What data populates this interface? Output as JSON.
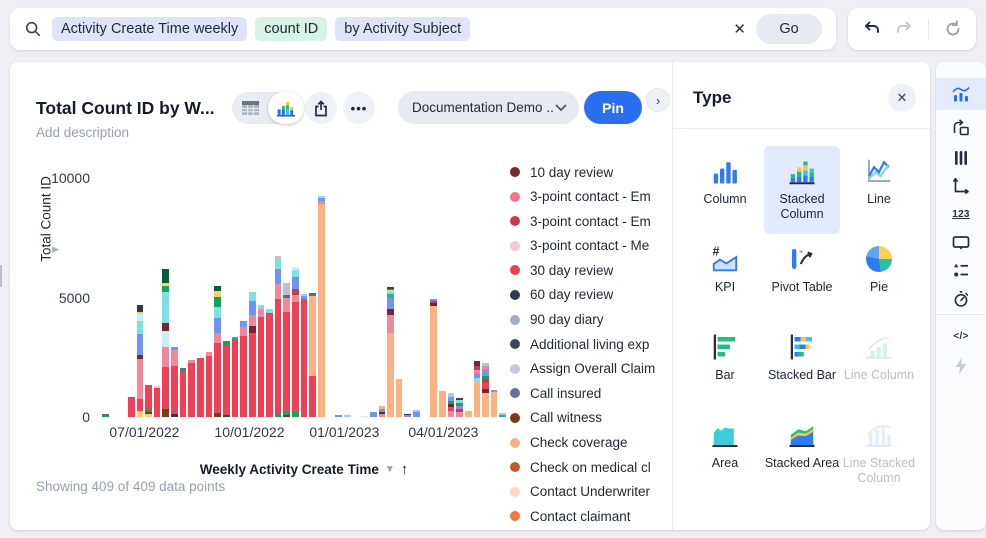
{
  "topbar": {
    "tokens": [
      {
        "text": "Activity Create Time weekly",
        "kind": "time"
      },
      {
        "text": "count ID",
        "kind": "measure"
      },
      {
        "text": "by Activity Subject",
        "kind": "attribute"
      }
    ],
    "clear_label": "✕",
    "go_label": "Go"
  },
  "chart_panel": {
    "title": "Total Count ID by W...",
    "description_placeholder": "Add description",
    "dataset_label": "Documentation Demo ...",
    "pin_label": "Pin",
    "footer": "Showing 409 of 409 data points",
    "x_axis_label": "Weekly Activity Create Time",
    "y_axis_label": "Total Count ID"
  },
  "legend": {
    "items": [
      {
        "label": "10 day review",
        "color": "#7c2333"
      },
      {
        "label": "3-point contact - Em",
        "color": "#ef7585"
      },
      {
        "label": "3-point contact - Em",
        "color": "#c13e52"
      },
      {
        "label": "3-point contact - Me",
        "color": "#f8c8d0"
      },
      {
        "label": "30 day review",
        "color": "#ee4156"
      },
      {
        "label": "60 day review",
        "color": "#2e3a50"
      },
      {
        "label": "90 day diary",
        "color": "#a3aec2"
      },
      {
        "label": "Additional living exp",
        "color": "#3c485c"
      },
      {
        "label": "Assign Overall Claim",
        "color": "#c3cbd8"
      },
      {
        "label": "Call insured",
        "color": "#67748c"
      },
      {
        "label": "Call witness",
        "color": "#7a3b16"
      },
      {
        "label": "Check coverage",
        "color": "#fcb183"
      },
      {
        "label": "Check on medical cl",
        "color": "#c45a24"
      },
      {
        "label": "Contact Underwriter",
        "color": "#fcd9c2"
      },
      {
        "label": "Contact claimant",
        "color": "#f4773c"
      }
    ]
  },
  "chart_data": {
    "type": "bar",
    "stacked": true,
    "title": "Total Count ID by Weekly Activity Create Time",
    "xlabel": "Weekly Activity Create Time",
    "ylabel": "Total Count ID",
    "ylim": [
      0,
      10000
    ],
    "y_ticks": [
      "10000",
      "5000",
      "0"
    ],
    "x_ticks": [
      {
        "label": "07/01/2022",
        "pos_pct": 10.5
      },
      {
        "label": "10/01/2022",
        "pos_pct": 36.5
      },
      {
        "label": "01/01/2023",
        "pos_pct": 60.0
      },
      {
        "label": "04/01/2023",
        "pos_pct": 84.5
      }
    ],
    "palette": {
      "red": "#ee4156",
      "pink": "#f2879a",
      "lightpink": "#f8c8d0",
      "maroon": "#7c2333",
      "darkred": "#c13e52",
      "navy": "#2e3a50",
      "slate": "#5d6b80",
      "lightslate": "#b9c2d0",
      "brown": "#7a3b16",
      "orange": "#fcb183",
      "burnt": "#c45a24",
      "peach": "#fcd9c2",
      "coral": "#f4773c",
      "blue": "#6d96f0",
      "lightblue": "#a9c7f7",
      "cyan": "#7ee0e3",
      "lightcyan": "#c9f0f2",
      "teal": "#2aaf9f",
      "green": "#18a15c",
      "darkgreen": "#0d5c38",
      "yellow": "#f6cf6e",
      "purple": "#9b86ef"
    },
    "bars": [
      [
        [
          "green",
          60
        ],
        [
          "slate",
          70
        ]
      ],
      [],
      [],
      [
        [
          "red",
          780
        ],
        [
          "green",
          60
        ]
      ],
      [
        [
          "yellow",
          260
        ],
        [
          "red",
          500
        ],
        [
          "pink",
          1650
        ],
        [
          "maroon",
          170
        ],
        [
          "blue",
          900
        ],
        [
          "cyan",
          550
        ],
        [
          "lightcyan",
          270
        ],
        [
          "yellow",
          100
        ],
        [
          "navy",
          300
        ]
      ],
      [
        [
          "yellow",
          120
        ],
        [
          "brown",
          110
        ],
        [
          "green",
          120
        ],
        [
          "red",
          1000
        ]
      ],
      [
        [
          "red",
          1230
        ],
        [
          "lightpink",
          70
        ]
      ],
      [
        [
          "brown",
          340
        ],
        [
          "red",
          1750
        ],
        [
          "pink",
          830
        ],
        [
          "lightcyan",
          680
        ],
        [
          "maroon",
          320
        ],
        [
          "cyan",
          1300
        ],
        [
          "green",
          280
        ],
        [
          "yellow",
          100
        ],
        [
          "darkgreen",
          600
        ]
      ],
      [
        [
          "navy",
          120
        ],
        [
          "red",
          2000
        ],
        [
          "pink",
          680
        ],
        [
          "blue",
          150
        ]
      ],
      [
        [
          "red",
          1900
        ],
        [
          "green",
          100
        ],
        [
          "slate",
          50
        ]
      ],
      [
        [
          "red",
          2280
        ],
        [
          "pink",
          120
        ]
      ],
      [
        [
          "red",
          2450
        ]
      ],
      [
        [
          "red",
          2550
        ],
        [
          "pink",
          150
        ]
      ],
      [
        [
          "brown",
          180
        ],
        [
          "red",
          2900
        ],
        [
          "pink",
          450
        ],
        [
          "blue",
          600
        ],
        [
          "cyan",
          480
        ],
        [
          "green",
          420
        ],
        [
          "yellow",
          250
        ],
        [
          "darkgreen",
          200
        ]
      ],
      [
        [
          "darkgreen",
          80
        ],
        [
          "red",
          2950
        ],
        [
          "green",
          170
        ]
      ],
      [
        [
          "red",
          3250
        ],
        [
          "teal",
          100
        ]
      ],
      [
        [
          "red",
          3400
        ],
        [
          "pink",
          350
        ],
        [
          "blue",
          250
        ]
      ],
      [
        [
          "red",
          3500
        ],
        [
          "maroon",
          300
        ],
        [
          "pink",
          450
        ],
        [
          "blue",
          600
        ],
        [
          "cyan",
          400
        ]
      ],
      [
        [
          "red",
          4200
        ],
        [
          "pink",
          300
        ],
        [
          "lightblue",
          200
        ]
      ],
      [
        [
          "red",
          4350
        ],
        [
          "cyan",
          150
        ]
      ],
      [
        [
          "green",
          150
        ],
        [
          "red",
          4800
        ],
        [
          "pink",
          600
        ],
        [
          "blue",
          650
        ],
        [
          "cyan",
          400
        ],
        [
          "lightslate",
          150
        ]
      ],
      [
        [
          "brown",
          100
        ],
        [
          "green",
          130
        ],
        [
          "red",
          4170
        ],
        [
          "pink",
          600
        ],
        [
          "slate",
          100
        ],
        [
          "lightslate",
          500
        ]
      ],
      [
        [
          "green",
          200
        ],
        [
          "red",
          4600
        ],
        [
          "pink",
          300
        ],
        [
          "darkred",
          250
        ],
        [
          "blue",
          500
        ],
        [
          "cyan",
          300
        ],
        [
          "lightcyan",
          150
        ]
      ],
      [
        [
          "red",
          4950
        ],
        [
          "blue",
          120
        ],
        [
          "lightblue",
          80
        ]
      ],
      [
        [
          "red",
          1700
        ],
        [
          "orange",
          3350
        ],
        [
          "slate",
          150
        ]
      ],
      [
        [
          "orange",
          8900
        ],
        [
          "pink",
          150
        ],
        [
          "blue",
          100
        ],
        [
          "yellow",
          50
        ],
        [
          "cyan",
          50
        ]
      ],
      [],
      [
        [
          "blue",
          100
        ]
      ],
      [
        [
          "lightblue",
          90
        ]
      ],
      [],
      [
        [
          "lightcyan",
          60
        ]
      ],
      [
        [
          "blue",
          200
        ]
      ],
      [
        [
          "pink",
          120
        ],
        [
          "navy",
          80
        ],
        [
          "blue",
          150
        ],
        [
          "orange",
          100
        ]
      ],
      [
        [
          "orange",
          3500
        ],
        [
          "pink",
          780
        ],
        [
          "maroon",
          250
        ],
        [
          "blue",
          450
        ],
        [
          "teal",
          150
        ],
        [
          "cyan",
          100
        ],
        [
          "yellow",
          80
        ],
        [
          "green",
          60
        ],
        [
          "darkgreen",
          80
        ]
      ],
      [
        [
          "orange",
          1600
        ]
      ],
      [
        [
          "purple",
          70
        ],
        [
          "navy",
          60
        ]
      ],
      [
        [
          "blue",
          200
        ],
        [
          "lightblue",
          100
        ]
      ],
      [],
      [
        [
          "orange",
          4650
        ],
        [
          "maroon",
          120
        ],
        [
          "darkred",
          100
        ],
        [
          "blue",
          60
        ]
      ],
      [
        [
          "orange",
          1100
        ]
      ],
      [
        [
          "pink",
          250
        ],
        [
          "red",
          180
        ],
        [
          "maroon",
          120
        ],
        [
          "green",
          140
        ],
        [
          "blue",
          160
        ],
        [
          "lightblue",
          150
        ]
      ],
      [
        [
          "pink",
          200
        ],
        [
          "darkred",
          150
        ],
        [
          "purple",
          120
        ],
        [
          "green",
          130
        ],
        [
          "cyan",
          120
        ],
        [
          "maroon",
          80
        ]
      ],
      [
        [
          "orange",
          250
        ]
      ],
      [
        [
          "orange",
          1500
        ],
        [
          "cyan",
          120
        ],
        [
          "blue",
          120
        ],
        [
          "purple",
          100
        ],
        [
          "pink",
          130
        ],
        [
          "darkred",
          180
        ],
        [
          "maroon",
          200
        ]
      ],
      [
        [
          "orange",
          1000
        ],
        [
          "maroon",
          180
        ],
        [
          "red",
          250
        ],
        [
          "darkred",
          150
        ],
        [
          "green",
          150
        ],
        [
          "blue",
          150
        ],
        [
          "purple",
          120
        ],
        [
          "pink",
          150
        ],
        [
          "cyan",
          100
        ]
      ],
      [
        [
          "orange",
          1050
        ],
        [
          "purple",
          60
        ]
      ],
      [
        [
          "teal",
          100
        ],
        [
          "lightblue",
          60
        ]
      ]
    ]
  },
  "type_panel": {
    "title": "Type",
    "tiles": [
      {
        "label": "Column",
        "icon": "column-chart-icon",
        "state": "normal"
      },
      {
        "label": "Stacked Column",
        "icon": "stacked-column-chart-icon",
        "state": "selected"
      },
      {
        "label": "Line",
        "icon": "line-chart-icon",
        "state": "normal"
      },
      {
        "label": "KPI",
        "icon": "kpi-icon",
        "state": "normal"
      },
      {
        "label": "Pivot Table",
        "icon": "pivot-table-icon",
        "state": "normal"
      },
      {
        "label": "Pie",
        "icon": "pie-chart-icon",
        "state": "normal"
      },
      {
        "label": "Bar",
        "icon": "bar-chart-icon",
        "state": "normal"
      },
      {
        "label": "Stacked Bar",
        "icon": "stacked-bar-chart-icon",
        "state": "normal"
      },
      {
        "label": "Line Column",
        "icon": "line-column-chart-icon",
        "state": "disabled"
      },
      {
        "label": "Area",
        "icon": "area-chart-icon",
        "state": "normal"
      },
      {
        "label": "Stacked Area",
        "icon": "stacked-area-chart-icon",
        "state": "normal"
      },
      {
        "label": "Line Stacked Column",
        "icon": "line-stacked-column-chart-icon",
        "state": "disabled"
      }
    ]
  },
  "sidebar": {
    "items": [
      {
        "icon": "chart-config-icon",
        "y": 16,
        "state": "active"
      },
      {
        "icon": "visualize-icon",
        "y": 50,
        "state": "normal"
      },
      {
        "icon": "columns-icon",
        "y": 80,
        "state": "normal"
      },
      {
        "icon": "axes-icon",
        "y": 108,
        "state": "normal"
      },
      {
        "icon": "number-format-icon",
        "y": 136,
        "state": "normal"
      },
      {
        "icon": "display-icon",
        "y": 165,
        "state": "normal"
      },
      {
        "icon": "conditional-formatting-icon",
        "y": 193,
        "state": "normal"
      },
      {
        "icon": "schedule-icon",
        "y": 221,
        "state": "normal"
      },
      {
        "icon": "divider",
        "y": 252,
        "state": "divider"
      },
      {
        "icon": "code-icon",
        "y": 258,
        "state": "normal"
      },
      {
        "icon": "spark-icon",
        "y": 288,
        "state": "disabled"
      }
    ]
  }
}
